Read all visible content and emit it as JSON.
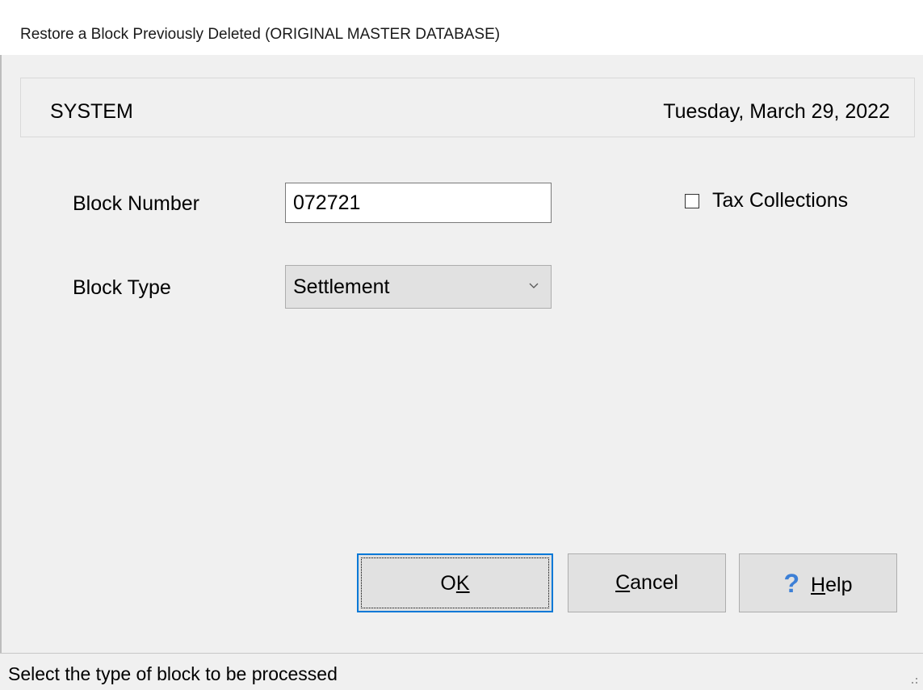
{
  "window": {
    "title": "Restore a Block Previously Deleted (ORIGINAL MASTER DATABASE)"
  },
  "header": {
    "left_text": "SYSTEM",
    "date_text": "Tuesday, March 29, 2022"
  },
  "form": {
    "block_number_label": "Block Number",
    "block_number_value": "072721",
    "block_type_label": "Block Type",
    "block_type_value": "Settlement",
    "tax_collections_label": "Tax Collections",
    "tax_collections_checked": false
  },
  "buttons": {
    "ok_pre": "O",
    "ok_ul": "K",
    "ok_post": "",
    "cancel_pre": "",
    "cancel_ul": "C",
    "cancel_post": "ancel",
    "help_pre": "",
    "help_ul": "H",
    "help_post": "elp",
    "help_icon": "?"
  },
  "statusbar": {
    "text": "Select the type of block to be processed"
  },
  "colors": {
    "accent": "#0078d7",
    "help_icon": "#3c7fd6"
  }
}
